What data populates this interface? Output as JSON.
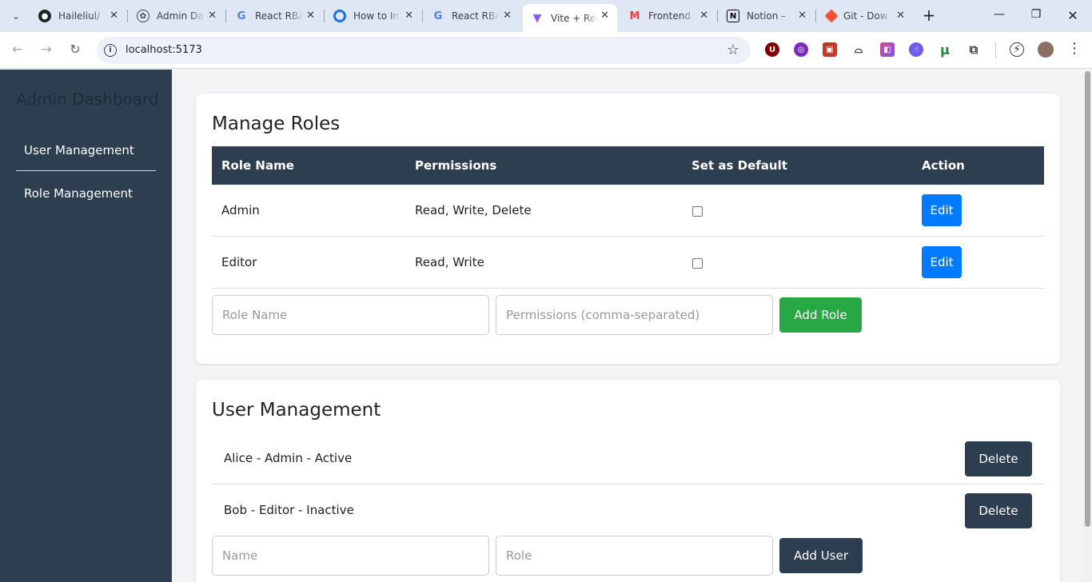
{
  "browser": {
    "tabs": [
      {
        "title": "Haileliul/",
        "icon": "github-icon",
        "color": "#1f2328"
      },
      {
        "title": "Admin Da",
        "icon": "openai-icon",
        "color": "#444444"
      },
      {
        "title": "React RBA",
        "icon": "google-icon",
        "color": "#4285f4"
      },
      {
        "title": "How to In",
        "icon": "ring-icon",
        "color": "#1a73e8"
      },
      {
        "title": "React RBA",
        "icon": "google-icon",
        "color": "#4285f4"
      },
      {
        "title": "Vite + Rea",
        "icon": "vite-icon",
        "color": "#8b5cf6"
      },
      {
        "title": "Frontend",
        "icon": "gmail-icon",
        "color": "#ea4335"
      },
      {
        "title": "Notion – ",
        "icon": "notion-icon",
        "color": "#000000"
      },
      {
        "title": "Git - Dow",
        "icon": "git-icon",
        "color": "#f05033"
      }
    ],
    "active_tab_index": 5,
    "url": "localhost:5173",
    "extensions": [
      {
        "name": "ublock-icon",
        "color": "#800000",
        "glyph": "U"
      },
      {
        "name": "extension-purple-icon",
        "color": "#7b2cbf",
        "glyph": "◎"
      },
      {
        "name": "extension-red-icon",
        "color": "#c0392b",
        "glyph": "▣"
      },
      {
        "name": "hat-icon",
        "color": "#ffffff",
        "glyph": "🎩"
      },
      {
        "name": "flag-icon",
        "color": "#8e44ad",
        "glyph": "◧"
      },
      {
        "name": "hand-icon",
        "color": "#6c5ce7",
        "glyph": "☝"
      },
      {
        "name": "utorrent-icon",
        "color": "#1b8a3a",
        "glyph": "µ"
      },
      {
        "name": "puzzle-icon",
        "color": "#ffffff",
        "glyph": "⧉"
      }
    ]
  },
  "sidebar": {
    "brand": "Admin Dashboard",
    "items": [
      {
        "label": "User Management"
      },
      {
        "label": "Role Management"
      }
    ]
  },
  "roles": {
    "title": "Manage Roles",
    "headers": [
      "Role Name",
      "Permissions",
      "Set as Default",
      "Action"
    ],
    "rows": [
      {
        "name": "Admin",
        "permissions": "Read, Write, Delete",
        "default": false,
        "action": "Edit"
      },
      {
        "name": "Editor",
        "permissions": "Read, Write",
        "default": false,
        "action": "Edit"
      }
    ],
    "name_placeholder": "Role Name",
    "permissions_placeholder": "Permissions (comma-separated)",
    "add_label": "Add Role"
  },
  "users": {
    "title": "User Management",
    "rows": [
      {
        "text": "Alice - Admin - Active",
        "action": "Delete"
      },
      {
        "text": "Bob - Editor - Inactive",
        "action": "Delete"
      }
    ],
    "name_placeholder": "Name",
    "role_placeholder": "Role",
    "add_label": "Add User"
  },
  "colors": {
    "sidebar": "#2c3e50",
    "edit_button": "#007bff",
    "add_role_button": "#28a745",
    "dark_button": "#2c3e50"
  }
}
